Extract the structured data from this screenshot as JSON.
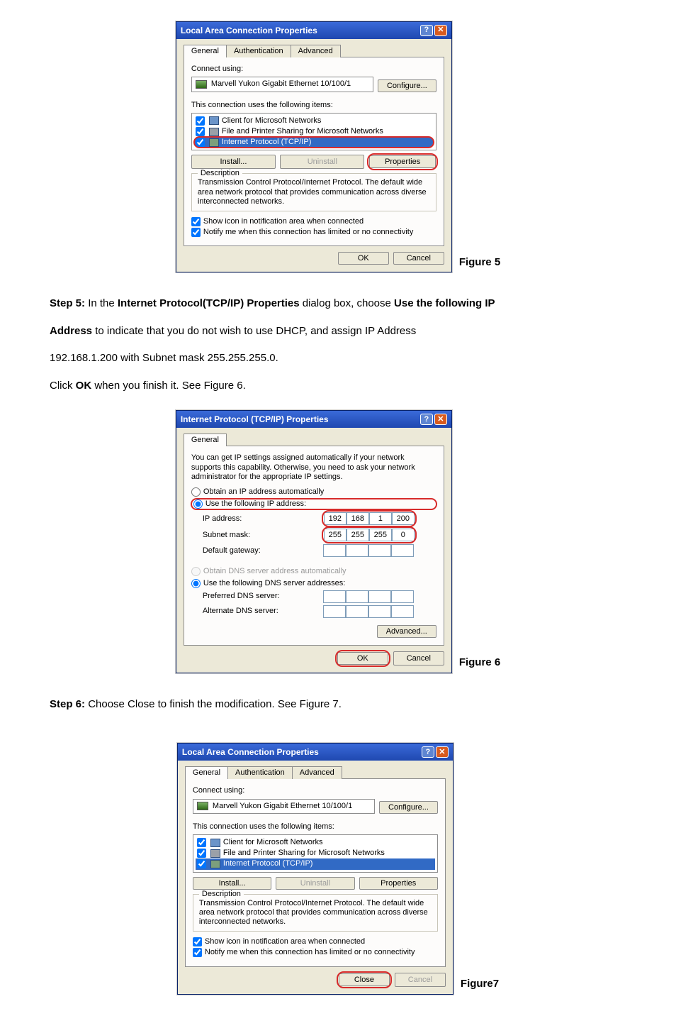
{
  "fig5": {
    "title": "Local Area Connection Properties",
    "tabs": [
      "General",
      "Authentication",
      "Advanced"
    ],
    "connect_using": "Connect using:",
    "adapter": "Marvell Yukon Gigabit Ethernet 10/100/1",
    "configure": "Configure...",
    "items_label": "This connection uses the following items:",
    "items": [
      "Client for Microsoft Networks",
      "File and Printer Sharing for Microsoft Networks",
      "Internet Protocol (TCP/IP)"
    ],
    "install": "Install...",
    "uninstall": "Uninstall",
    "properties": "Properties",
    "desc_legend": "Description",
    "desc_text": "Transmission Control Protocol/Internet Protocol. The default wide area network protocol that provides communication across diverse interconnected networks.",
    "show_icon": "Show icon in notification area when connected",
    "notify": "Notify me when this connection has limited or no connectivity",
    "ok": "OK",
    "cancel": "Cancel",
    "figure": "Figure 5"
  },
  "step5": {
    "line1a": "Step 5: ",
    "line1b": "In the ",
    "line1c": "Internet Protocol(TCP/IP) Properties",
    "line1d": " dialog box, choose ",
    "line1e": "Use the following IP",
    "line2a": "Address",
    "line2b": " to indicate that you do not wish to use DHCP, and assign IP Address",
    "line3": "192.168.1.200 with Subnet mask 255.255.255.0.",
    "line4a": "Click ",
    "line4b": "OK",
    "line4c": " when you finish it. See Figure 6."
  },
  "fig6": {
    "title": "Internet Protocol (TCP/IP) Properties",
    "tab": "General",
    "note": "You can get IP settings assigned automatically if your network supports this capability. Otherwise, you need to ask your network administrator for the appropriate IP settings.",
    "auto_ip": "Obtain an IP address automatically",
    "use_ip": "Use the following IP address:",
    "ip_label": "IP address:",
    "subnet_label": "Subnet mask:",
    "gateway_label": "Default gateway:",
    "auto_dns": "Obtain DNS server address automatically",
    "use_dns": "Use the following DNS server addresses:",
    "pref_dns": "Preferred DNS server:",
    "alt_dns": "Alternate DNS server:",
    "ip": [
      "192",
      "168",
      "1",
      "200"
    ],
    "mask": [
      "255",
      "255",
      "255",
      "0"
    ],
    "advanced": "Advanced...",
    "ok": "OK",
    "cancel": "Cancel",
    "figure": "Figure 6"
  },
  "step6": {
    "line": "Step 6: ",
    "rest": "Choose Close to finish the modification. See Figure 7."
  },
  "fig7": {
    "title": "Local Area Connection Properties",
    "tabs": [
      "General",
      "Authentication",
      "Advanced"
    ],
    "connect_using": "Connect using:",
    "adapter": "Marvell Yukon Gigabit Ethernet 10/100/1",
    "configure": "Configure...",
    "items_label": "This connection uses the following items:",
    "items": [
      "Client for Microsoft Networks",
      "File and Printer Sharing for Microsoft Networks",
      "Internet Protocol (TCP/IP)"
    ],
    "install": "Install...",
    "uninstall": "Uninstall",
    "properties": "Properties",
    "desc_legend": "Description",
    "desc_text": "Transmission Control Protocol/Internet Protocol. The default wide area network protocol that provides communication across diverse interconnected networks.",
    "show_icon": "Show icon in notification area when connected",
    "notify": "Notify me when this connection has limited or no connectivity",
    "close": "Close",
    "cancel": "Cancel",
    "figure": "Figure7"
  }
}
